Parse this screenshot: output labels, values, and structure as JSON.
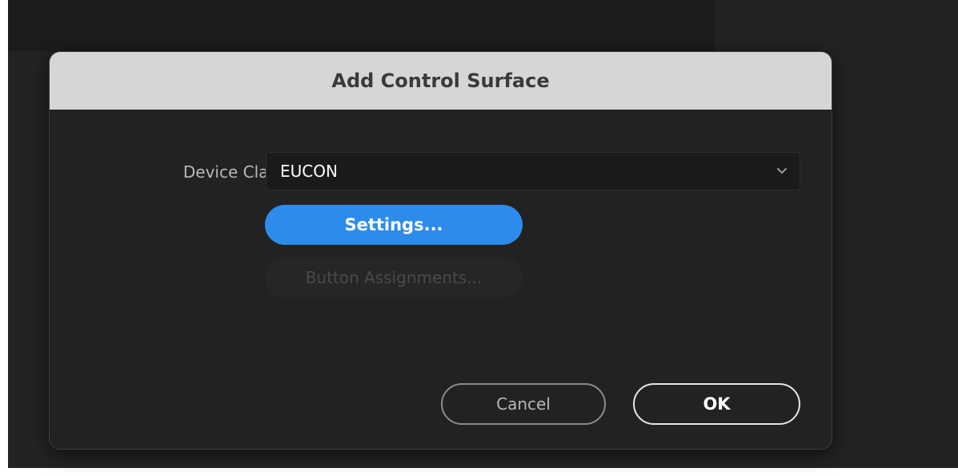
{
  "dialog": {
    "title": "Add Control Surface",
    "device_class_label": "Device Class:",
    "device_class_value": "EUCON",
    "settings_label": "Settings...",
    "button_assignments_label": "Button Assignments...",
    "cancel_label": "Cancel",
    "ok_label": "OK"
  },
  "icons": {
    "dropdown": "chevron-down-icon"
  },
  "colors": {
    "accent": "#2d8ceb",
    "titlebar": "#d6d6d6",
    "dialog_bg": "#222222"
  }
}
